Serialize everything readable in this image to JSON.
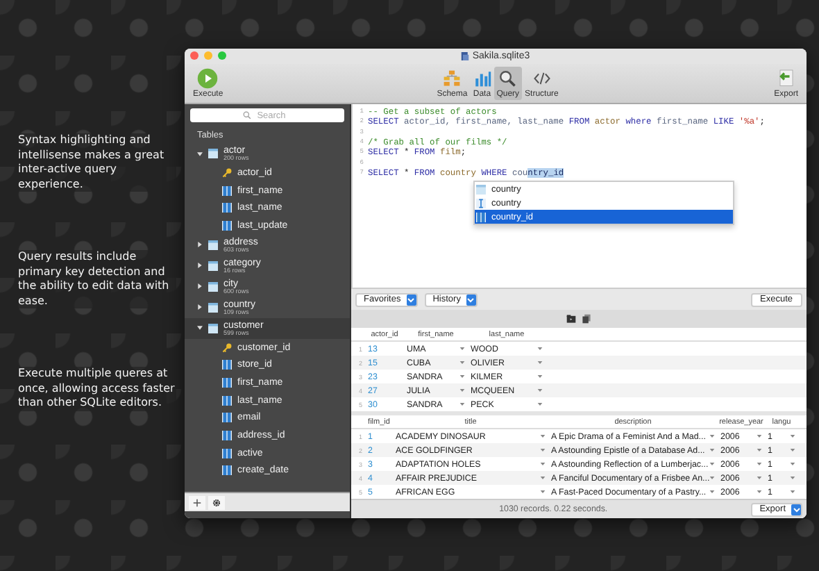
{
  "captions": [
    "Syntax highlighting and intellisense makes a great inter-active query experience.",
    "Query results include primary key detection and the ability to edit data with ease.",
    "Execute multiple queres at once, allowing access faster than other SQLite editors."
  ],
  "window": {
    "title": "Sakila.sqlite3"
  },
  "toolbar": {
    "execute": "Execute",
    "export": "Export",
    "views": [
      {
        "label": "Schema",
        "selected": false
      },
      {
        "label": "Data",
        "selected": false
      },
      {
        "label": "Query",
        "selected": true
      },
      {
        "label": "Structure",
        "selected": false
      }
    ]
  },
  "sidebar": {
    "search_placeholder": "Search",
    "section": "Tables",
    "tables": [
      {
        "name": "actor",
        "rows": "200 rows",
        "expanded": true,
        "selected": false,
        "children": [
          {
            "name": "actor_id",
            "kind": "key"
          },
          {
            "name": "first_name",
            "kind": "column"
          },
          {
            "name": "last_name",
            "kind": "column"
          },
          {
            "name": "last_update",
            "kind": "column"
          }
        ]
      },
      {
        "name": "address",
        "rows": "603 rows",
        "expanded": false,
        "selected": false
      },
      {
        "name": "category",
        "rows": "16 rows",
        "expanded": false,
        "selected": false
      },
      {
        "name": "city",
        "rows": "600 rows",
        "expanded": false,
        "selected": false
      },
      {
        "name": "country",
        "rows": "109 rows",
        "expanded": false,
        "selected": false
      },
      {
        "name": "customer",
        "rows": "599 rows",
        "expanded": true,
        "selected": true,
        "children": [
          {
            "name": "customer_id",
            "kind": "key"
          },
          {
            "name": "store_id",
            "kind": "column"
          },
          {
            "name": "first_name",
            "kind": "column"
          },
          {
            "name": "last_name",
            "kind": "column"
          },
          {
            "name": "email",
            "kind": "column"
          },
          {
            "name": "address_id",
            "kind": "column"
          },
          {
            "name": "active",
            "kind": "column"
          },
          {
            "name": "create_date",
            "kind": "column"
          }
        ]
      }
    ]
  },
  "editor": {
    "lines": [
      {
        "number": "1",
        "tokens": [
          {
            "kind": "comment",
            "text": "-- Get a subset of actors"
          }
        ]
      },
      {
        "number": "2",
        "tokens": [
          {
            "kind": "keyword",
            "text": "SELECT"
          },
          {
            "kind": "column",
            "text": " actor_id, first_name, last_name "
          },
          {
            "kind": "keyword",
            "text": "FROM"
          },
          {
            "kind": "table",
            "text": " actor "
          },
          {
            "kind": "keyword",
            "text": "where"
          },
          {
            "kind": "column",
            "text": " first_name "
          },
          {
            "kind": "keyword",
            "text": "LIKE"
          },
          {
            "kind": "string",
            "text": " '%a'"
          },
          {
            "kind": "plain",
            "text": ";"
          }
        ]
      },
      {
        "number": "3"
      },
      {
        "number": "4",
        "tokens": [
          {
            "kind": "comment",
            "text": "/* Grab all of our films */"
          }
        ]
      },
      {
        "number": "5",
        "tokens": [
          {
            "kind": "keyword",
            "text": "SELECT"
          },
          {
            "kind": "plain",
            "text": " * "
          },
          {
            "kind": "keyword",
            "text": "FROM"
          },
          {
            "kind": "table",
            "text": " film"
          },
          {
            "kind": "plain",
            "text": ";"
          }
        ]
      },
      {
        "number": "6"
      },
      {
        "number": "7",
        "tokens": [
          {
            "kind": "keyword",
            "text": "SELECT"
          },
          {
            "kind": "plain",
            "text": " * "
          },
          {
            "kind": "keyword",
            "text": "FROM"
          },
          {
            "kind": "table",
            "text": " country "
          },
          {
            "kind": "keyword",
            "text": "WHERE"
          },
          {
            "kind": "column",
            "text": " cou"
          },
          {
            "kind": "selected",
            "text": "ntry_id"
          }
        ]
      }
    ],
    "autocomplete": [
      {
        "label": "country",
        "kind": "table",
        "selected": false
      },
      {
        "label": "country",
        "kind": "text",
        "selected": false
      },
      {
        "label": "country_id",
        "kind": "column",
        "selected": true
      }
    ]
  },
  "query_bar": {
    "favorites": "Favorites",
    "history": "History",
    "execute": "Execute"
  },
  "results": [
    {
      "columns": [
        {
          "name": "actor_id",
          "primary_key": true
        },
        {
          "name": "first_name",
          "primary_key": false
        },
        {
          "name": "last_name",
          "primary_key": false
        }
      ],
      "rows": [
        {
          "number": "1",
          "cells": [
            "13",
            "UMA",
            "WOOD"
          ]
        },
        {
          "number": "2",
          "cells": [
            "15",
            "CUBA",
            "OLIVIER"
          ]
        },
        {
          "number": "3",
          "cells": [
            "23",
            "SANDRA",
            "KILMER"
          ]
        },
        {
          "number": "4",
          "cells": [
            "27",
            "JULIA",
            "MCQUEEN"
          ]
        },
        {
          "number": "5",
          "cells": [
            "30",
            "SANDRA",
            "PECK"
          ]
        }
      ]
    },
    {
      "columns": [
        {
          "name": "film_id",
          "primary_key": true
        },
        {
          "name": "title",
          "primary_key": false
        },
        {
          "name": "description",
          "primary_key": false
        },
        {
          "name": "release_year",
          "primary_key": false
        },
        {
          "name": "langu",
          "primary_key": false
        }
      ],
      "rows": [
        {
          "number": "1",
          "cells": [
            "1",
            "ACADEMY DINOSAUR",
            "A Epic Drama of a Feminist And a Mad...",
            "2006",
            "1"
          ]
        },
        {
          "number": "2",
          "cells": [
            "2",
            "ACE GOLDFINGER",
            "A Astounding Epistle of a Database Ad...",
            "2006",
            "1"
          ]
        },
        {
          "number": "3",
          "cells": [
            "3",
            "ADAPTATION HOLES",
            "A Astounding Reflection of a Lumberjac...",
            "2006",
            "1"
          ]
        },
        {
          "number": "4",
          "cells": [
            "4",
            "AFFAIR PREJUDICE",
            "A Fanciful Documentary of a Frisbee An...",
            "2006",
            "1"
          ]
        },
        {
          "number": "5",
          "cells": [
            "5",
            "AFRICAN EGG",
            "A Fast-Paced Documentary of a Pastry...",
            "2006",
            "1"
          ]
        }
      ]
    }
  ],
  "status": "1030 records. 0.22 seconds.",
  "export": "Export"
}
